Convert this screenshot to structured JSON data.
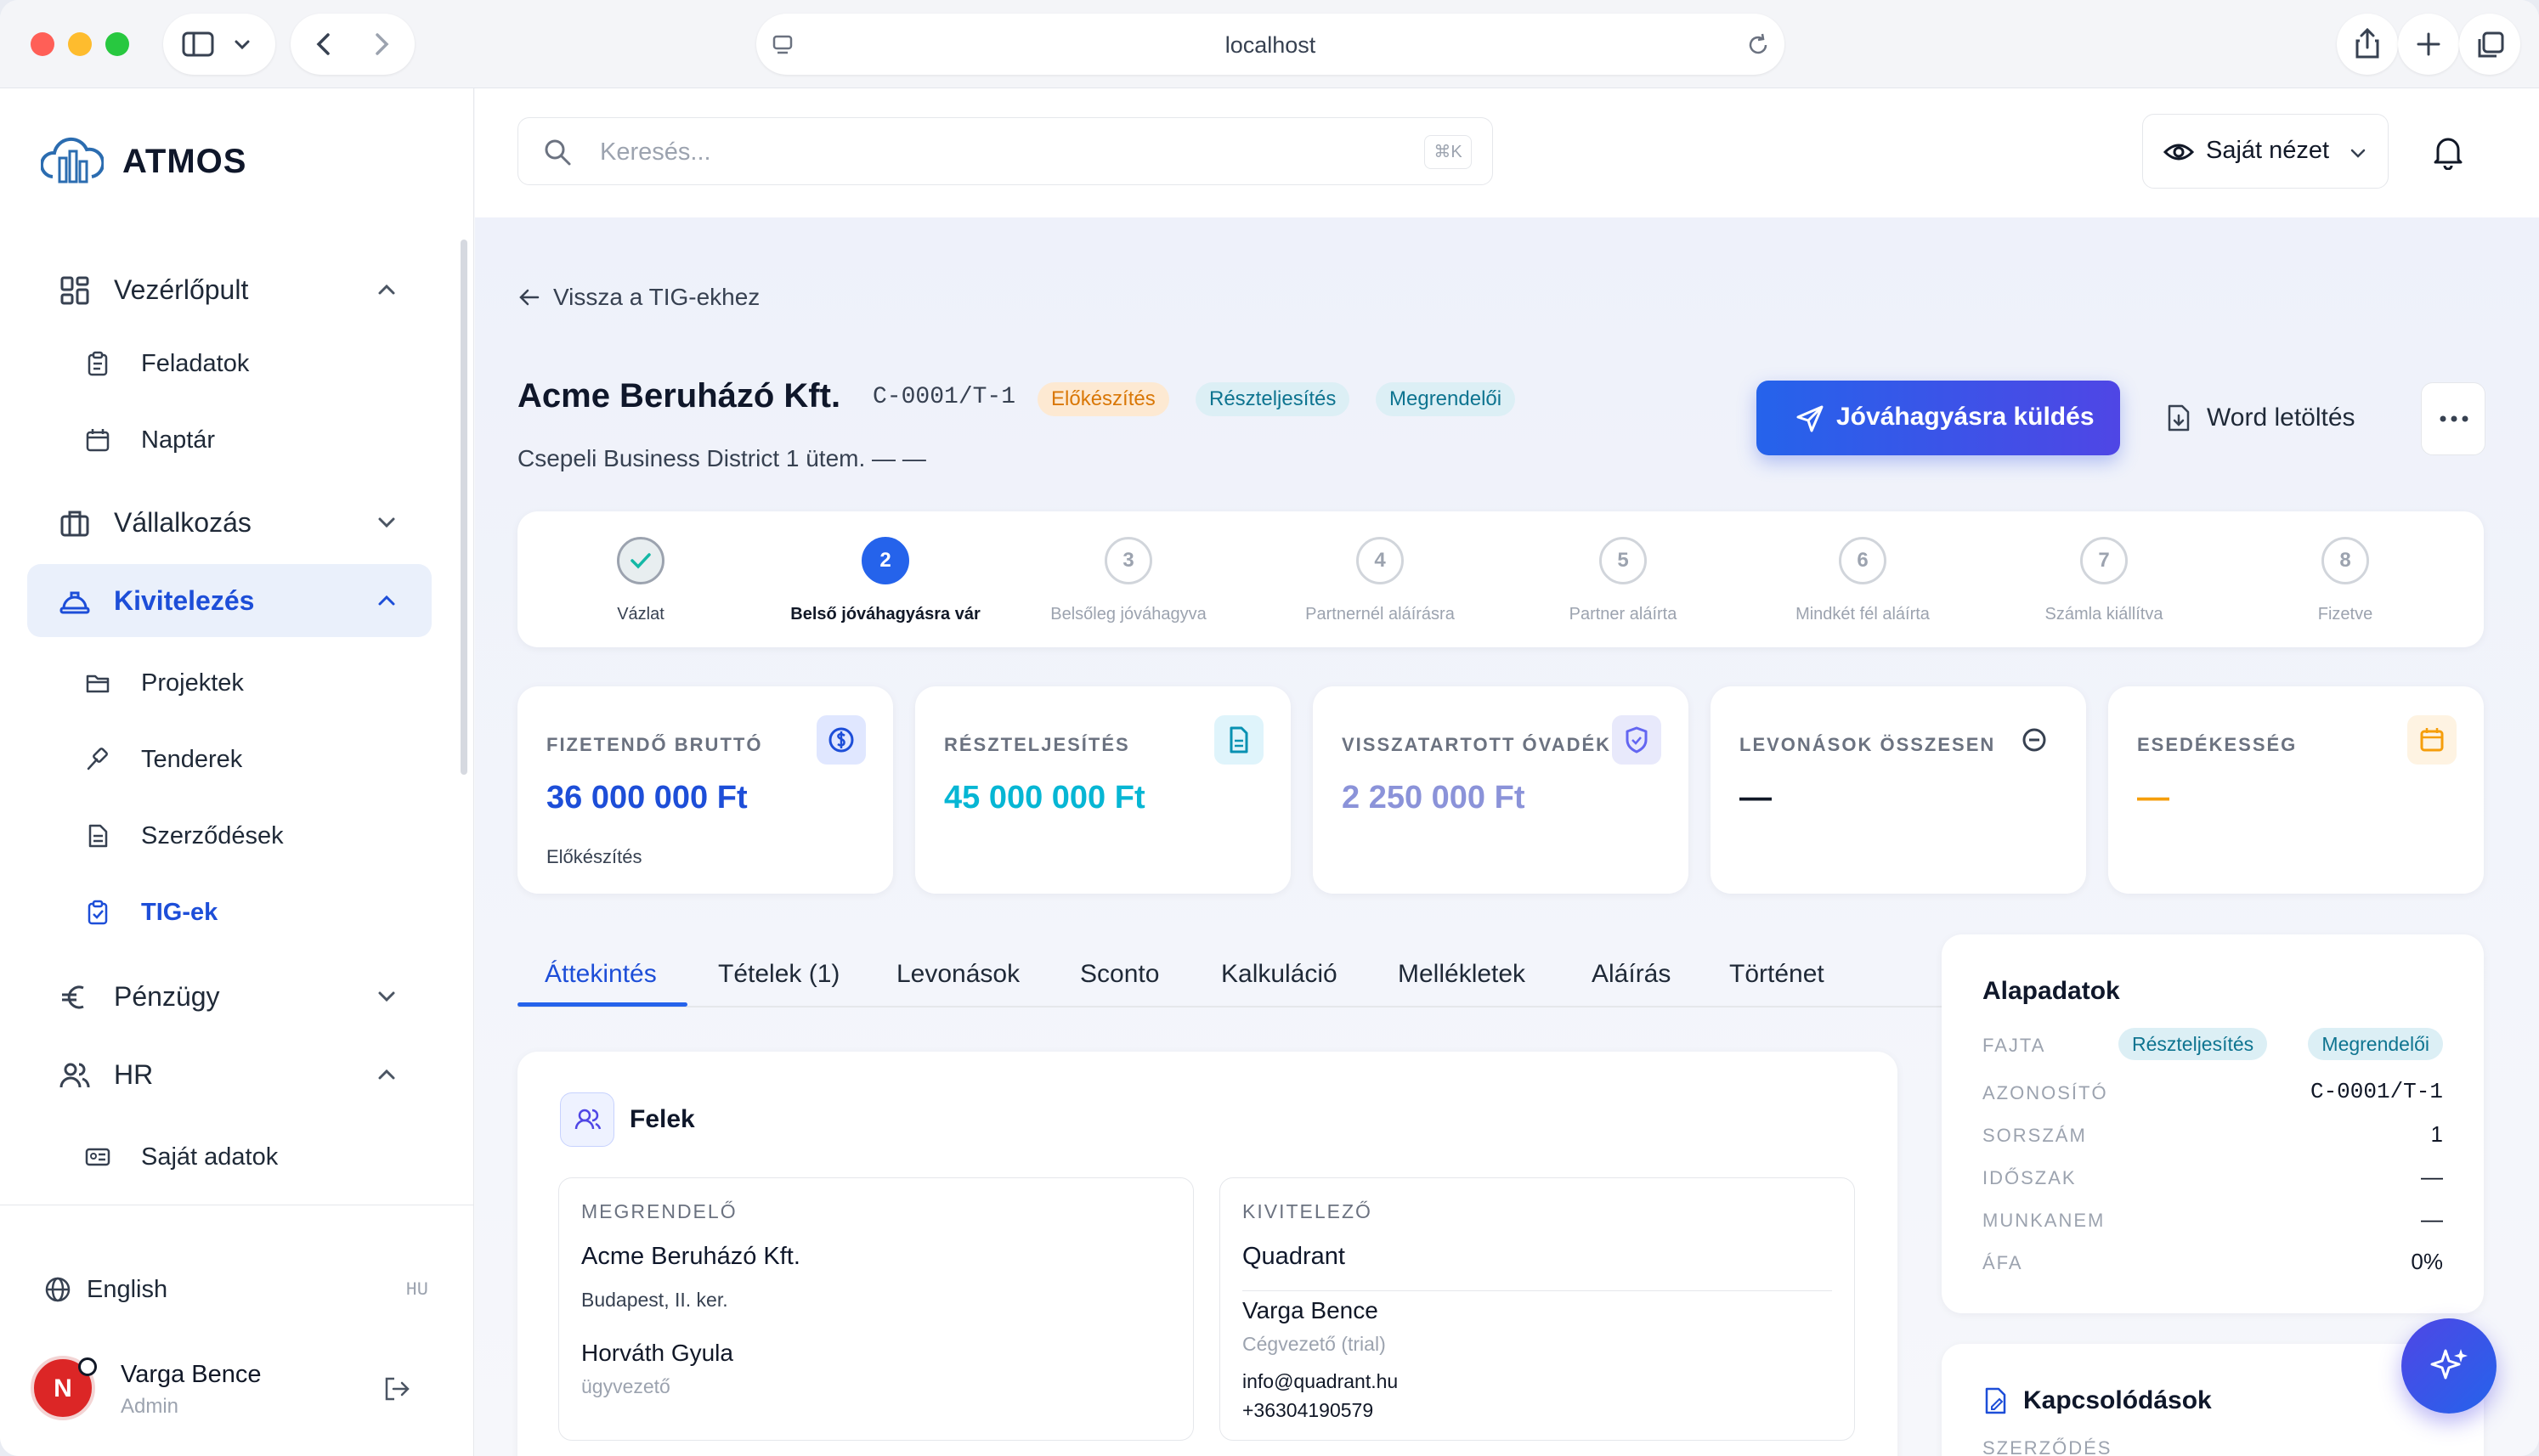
{
  "browser": {
    "url": "localhost"
  },
  "sidebar": {
    "logo_text": "ATMOS",
    "nav": [
      {
        "label": "Vezérlőpult",
        "icon": "dashboard-grid-icon",
        "expanded": true
      },
      {
        "label": "Vállalkozás",
        "icon": "briefcase-icon",
        "expanded": false
      },
      {
        "label": "Kivitelezés",
        "icon": "helmet-icon",
        "expanded": true,
        "active": true
      },
      {
        "label": "Pénzügy",
        "icon": "euro-icon",
        "expanded": false
      },
      {
        "label": "HR",
        "icon": "users-icon",
        "expanded": true
      }
    ],
    "subitems": {
      "vezerlopult": [
        {
          "label": "Feladatok",
          "icon": "clipboard-icon"
        },
        {
          "label": "Naptár",
          "icon": "calendar-icon"
        }
      ],
      "kivitelezes": [
        {
          "label": "Projektek",
          "icon": "folder-icon"
        },
        {
          "label": "Tenderek",
          "icon": "gavel-icon"
        },
        {
          "label": "Szerződések",
          "icon": "document-icon"
        },
        {
          "label": "TIG-ek",
          "icon": "clipboard-check-icon",
          "active": true
        }
      ],
      "hr": [
        {
          "label": "Saját adatok",
          "icon": "id-card-icon"
        }
      ]
    },
    "language": {
      "label": "English",
      "code": "HU"
    },
    "user": {
      "name": "Varga Bence",
      "role": "Admin",
      "avatar_letter": "N"
    }
  },
  "topbar": {
    "search_placeholder": "Keresés...",
    "search_shortcut": "⌘K",
    "view_label": "Saját nézet"
  },
  "page": {
    "back_label": "Vissza a TIG-ekhez",
    "title": "Acme Beruházó Kft.",
    "code": "C-0001/T-1",
    "badges": [
      {
        "label": "Előkészítés",
        "color": "#d97706",
        "bg": "#fde9d2"
      },
      {
        "label": "Részteljesítés",
        "color": "#0e7490",
        "bg": "#dceff5"
      },
      {
        "label": "Megrendelői",
        "color": "#0e7490",
        "bg": "#dceff5"
      }
    ],
    "subtitle": "Csepeli Business District 1 ütem. — —",
    "primary_action": "Jóváhagyásra küldés",
    "word_action": "Word letöltés"
  },
  "stepper": [
    {
      "num": "",
      "label": "Vázlat",
      "state": "done"
    },
    {
      "num": "2",
      "label": "Belső jóváhagyásra vár",
      "state": "current"
    },
    {
      "num": "3",
      "label": "Belsőleg jóváhagyva",
      "state": "todo"
    },
    {
      "num": "4",
      "label": "Partnernél aláírásra",
      "state": "todo"
    },
    {
      "num": "5",
      "label": "Partner aláírta",
      "state": "todo"
    },
    {
      "num": "6",
      "label": "Mindkét fél aláírta",
      "state": "todo"
    },
    {
      "num": "7",
      "label": "Számla kiállítva",
      "state": "todo"
    },
    {
      "num": "8",
      "label": "Fizetve",
      "state": "todo"
    }
  ],
  "kpis": [
    {
      "label": "FIZETENDŐ BRUTTÓ",
      "value": "36 000 000 Ft",
      "sub": "Előkészítés",
      "color": "#1d4ed8",
      "icon": "dollar-circle-icon",
      "icon_bg": "#e0e7ff"
    },
    {
      "label": "RÉSZTELJESÍTÉS",
      "value": "45 000 000 Ft",
      "sub": "",
      "color": "#06b6d4",
      "icon": "document-icon",
      "icon_bg": "#dff4fb"
    },
    {
      "label": "VISSZATARTOTT ÓVADÉK",
      "value": "2 250 000 Ft",
      "sub": "",
      "color": "#8b93d9",
      "icon": "shield-icon",
      "icon_bg": "#e8e9fb"
    },
    {
      "label": "LEVONÁSOK ÖSSZESEN",
      "value": "—",
      "sub": "",
      "color": "#111827",
      "icon": "minus-circle-icon",
      "icon_bg": "#ffffff"
    },
    {
      "label": "ESEDÉKESSÉG",
      "value": "—",
      "sub": "",
      "color": "#f59e0b",
      "icon": "calendar-icon",
      "icon_bg": "#fef3e2"
    }
  ],
  "tabs": [
    {
      "label": "Áttekintés",
      "active": true
    },
    {
      "label": "Tételek (1)"
    },
    {
      "label": "Levonások"
    },
    {
      "label": "Sconto"
    },
    {
      "label": "Kalkuláció"
    },
    {
      "label": "Mellékletek"
    },
    {
      "label": "Aláírás"
    },
    {
      "label": "Történet"
    }
  ],
  "parties": {
    "title": "Felek",
    "customer": {
      "label": "MEGRENDELŐ",
      "name": "Acme Beruházó Kft.",
      "address": "Budapest, II. ker.",
      "contact_name": "Horváth Gyula",
      "contact_role": "ügyvezető"
    },
    "contractor": {
      "label": "KIVITELEZŐ",
      "name": "Quadrant",
      "contact_name": "Varga Bence",
      "contact_role": "Cégvezető (trial)",
      "email": "info@quadrant.hu",
      "phone": "+36304190579"
    }
  },
  "basic": {
    "title": "Alapadatok",
    "fajta_label": "FAJTA",
    "fajta_badges": [
      "Részteljesítés",
      "Megrendelői"
    ],
    "rows": [
      {
        "key": "AZONOSÍTÓ",
        "value": "C-0001/T-1"
      },
      {
        "key": "SORSZÁM",
        "value": "1"
      },
      {
        "key": "IDŐSZAK",
        "value": "—"
      },
      {
        "key": "MUNKANEM",
        "value": "—"
      },
      {
        "key": "ÁFA",
        "value": "0%"
      }
    ]
  },
  "related": {
    "title": "Kapcsolódások",
    "first_label": "SZERZŐDÉS"
  }
}
